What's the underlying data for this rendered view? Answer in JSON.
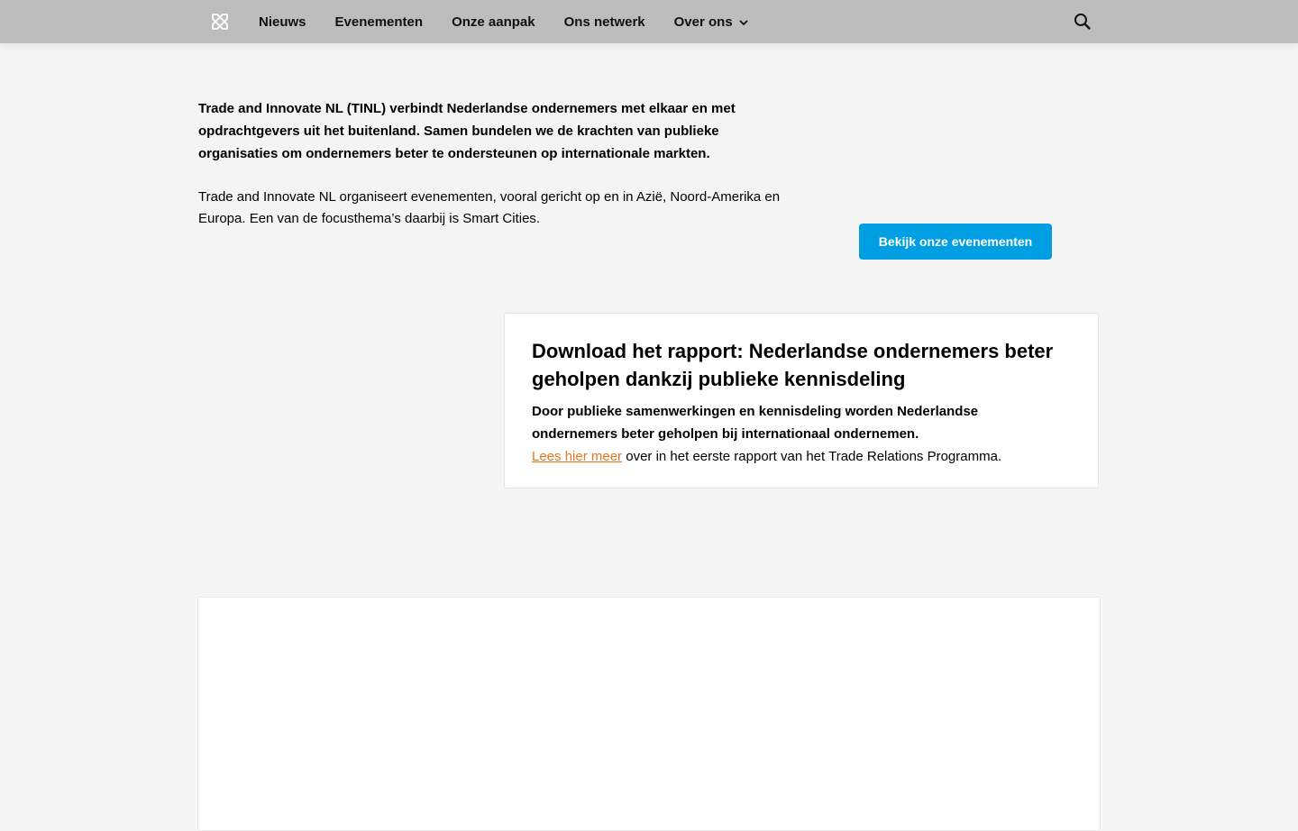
{
  "header": {
    "logo_icon": "crossed-arrows-logo-icon",
    "nav": [
      {
        "label": "Nieuws"
      },
      {
        "label": "Evenementen"
      },
      {
        "label": "Onze aanpak"
      },
      {
        "label": "Ons netwerk"
      },
      {
        "label": "Over ons",
        "has_dropdown": true
      }
    ],
    "search_icon": "search-icon"
  },
  "intro": {
    "lead": "Trade and Innovate NL (TINL) verbindt Nederlandse ondernemers met elkaar en met opdrachtgevers uit het buitenland. Samen bundelen we de krachten van publieke organisaties om ondernemers beter te ondersteunen op internationale markten.",
    "body": "Trade and Innovate NL organiseert evenementen, vooral gericht op en in Azië, Noord-Amerika en Europa. Een van de focusthema’s daarbij is Smart Cities.",
    "cta_label": "Bekijk onze evenementen"
  },
  "report_card": {
    "title": "Download het rapport: Nederlandse ondernemers beter geholpen dankzij publieke kennisdeling",
    "lead": "Door publieke samenwerkingen en kennisdeling worden Nederlandse ondernemers beter geholpen bij internationaal ondernemen.",
    "link_label": "Lees hier meer",
    "link_suffix": " over in het eerste rapport van het Trade Relations Programma."
  },
  "colors": {
    "topbar": "#bdbdbd",
    "background": "#f4f4f4",
    "cta": "#009fe3",
    "link": "#e8751a"
  }
}
